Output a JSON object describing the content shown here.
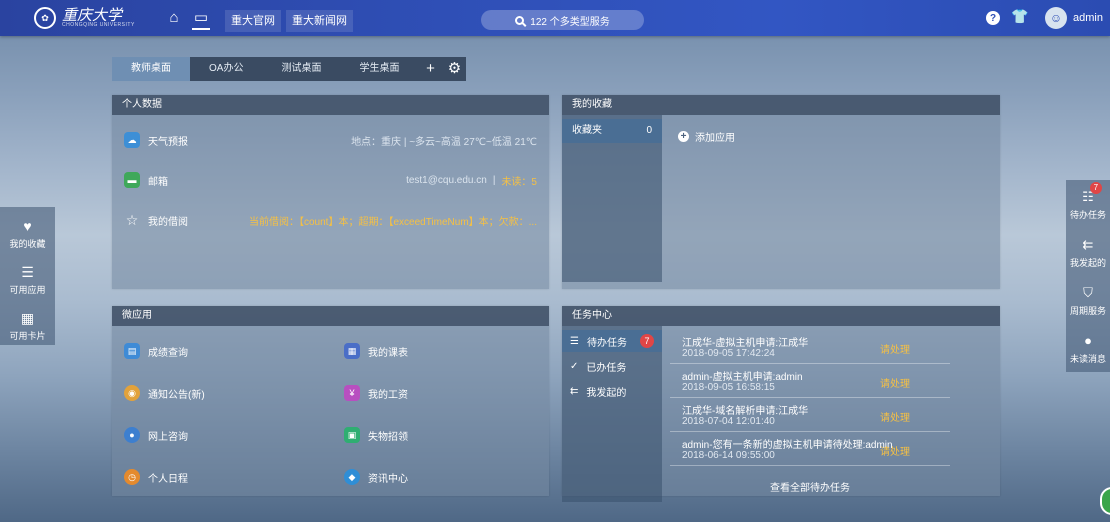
{
  "header": {
    "logo_text": "重庆大学",
    "logo_sub": "CHONGQING UNIVERSITY",
    "home_icon": "home-icon",
    "desktop_icon": "desktop-icon",
    "links": [
      "重大官网",
      "重大新闻网"
    ],
    "search_label": "122 个多类型服务",
    "help_icon": "help-icon",
    "shirt_icon": "shirt-icon",
    "user_name": "admin"
  },
  "tabs": [
    "教师桌面",
    "OA办公",
    "测试桌面",
    "学生桌面"
  ],
  "personal": {
    "title": "个人数据",
    "weather": {
      "label": "天气预报",
      "value": "地点：重庆 | ~多云~高温 27℃~低温 21℃"
    },
    "mail": {
      "label": "邮箱",
      "address": "test1@cqu.edu.cn",
      "sep": "|",
      "unread": "未读：5"
    },
    "borrow": {
      "label": "我的借阅",
      "value": "当前借阅：【count】本；超期：【exceedTimeNum】本；欠款：..."
    }
  },
  "favorites": {
    "title": "我的收藏",
    "folder": {
      "label": "收藏夹",
      "count": "0"
    },
    "add_app": "添加应用"
  },
  "micro": {
    "title": "微应用",
    "items": [
      {
        "label": "成绩查询",
        "color": "#3f8bd6"
      },
      {
        "label": "我的课表",
        "color": "#4a6ec7"
      },
      {
        "label": "通知公告(新)",
        "color": "#e2a23b"
      },
      {
        "label": "我的工资",
        "color": "#b84fc0"
      },
      {
        "label": "网上咨询",
        "color": "#3d7fcf"
      },
      {
        "label": "失物招领",
        "color": "#2fae72"
      },
      {
        "label": "个人日程",
        "color": "#e48a2e"
      },
      {
        "label": "资讯中心",
        "color": "#2f8ed6"
      }
    ]
  },
  "tasks": {
    "title": "任务中心",
    "nav": [
      {
        "label": "待办任务",
        "badge": "7",
        "icon": "list-icon"
      },
      {
        "label": "已办任务",
        "badge": "",
        "icon": "check-icon"
      },
      {
        "label": "我发起的",
        "badge": "",
        "icon": "branch-icon"
      }
    ],
    "rows": [
      {
        "title": "江成华-虚拟主机申请:江成华",
        "date": "2018-09-05 17:42:24",
        "action": "请处理"
      },
      {
        "title": "admin-虚拟主机申请:admin",
        "date": "2018-09-05 16:58:15",
        "action": "请处理"
      },
      {
        "title": "江成华-域名解析申请:江成华",
        "date": "2018-07-04 12:01:40",
        "action": "请处理"
      },
      {
        "title": "admin-您有一条新的虚拟主机申请待处理:admin",
        "date": "2018-06-14 09:55:00",
        "action": "请处理"
      }
    ],
    "view_all": "查看全部待办任务"
  },
  "left_sidebar": [
    {
      "label": "我的收藏",
      "icon": "heart-icon"
    },
    {
      "label": "可用应用",
      "icon": "list-icon"
    },
    {
      "label": "可用卡片",
      "icon": "grid-icon"
    }
  ],
  "right_sidebar": [
    {
      "label": "待办任务",
      "icon": "todo-icon",
      "badge": "7"
    },
    {
      "label": "我发起的",
      "icon": "branch-icon",
      "badge": ""
    },
    {
      "label": "周期服务",
      "icon": "shield-check-icon",
      "badge": ""
    },
    {
      "label": "未读消息",
      "icon": "chat-icon",
      "badge": ""
    }
  ]
}
